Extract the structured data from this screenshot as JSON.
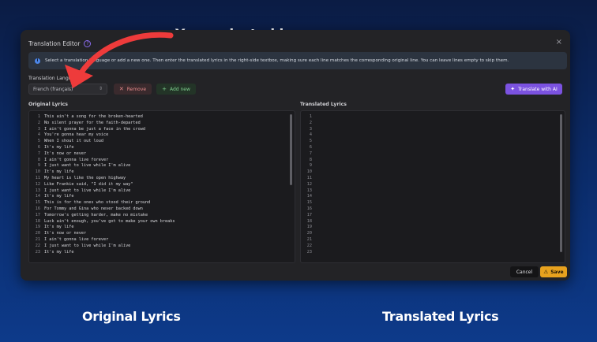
{
  "captions": {
    "top": "Your selected language",
    "bottom_left": "Original Lyrics",
    "bottom_right": "Translated Lyrics"
  },
  "dialog": {
    "title": "Translation Editor",
    "help_glyph": "?",
    "close_glyph": "×",
    "info_text": "Select a translation language or add a new one. Then enter the translated lyrics in the right-side textbox, making sure each line matches the corresponding original line. You can leave lines empty to skip them.",
    "language_label": "Translation Language",
    "language_value": "French (français)",
    "remove_label": "Remove",
    "add_label": "Add new",
    "ai_label": "Translate with AI",
    "original_title": "Original Lyrics",
    "translated_title": "Translated Lyrics",
    "cancel_label": "Cancel",
    "save_label": "Save"
  },
  "original_lines": [
    "This ain't a song for the broken-hearted",
    "No silent prayer for the faith-departed",
    "I ain't gonna be just a face in the crowd",
    "You're gonna hear my voice",
    "When I shout it out loud",
    "It's my life",
    "It's now or never",
    "I ain't gonna live forever",
    "I just want to live while I'm alive",
    "It's my life",
    "My heart is like the open highway",
    "Like Frankie said, \"I did it my way\"",
    "I just want to live while I'm alive",
    "It's my life",
    "This is for the ones who stood their ground",
    "For Tommy and Gina who never backed down",
    "Tomorrow's getting harder, make no mistake",
    "Luck ain't enough, you've got to make your own breaks",
    "It's my life",
    "It's now or never",
    "I ain't gonna live forever",
    "I just want to live while I'm alive",
    "It's my life"
  ],
  "line_numbers": [
    "1",
    "2",
    "3",
    "4",
    "5",
    "6",
    "7",
    "8",
    "9",
    "10",
    "11",
    "12",
    "13",
    "14",
    "15",
    "16",
    "17",
    "18",
    "19",
    "20",
    "21",
    "22",
    "23"
  ]
}
